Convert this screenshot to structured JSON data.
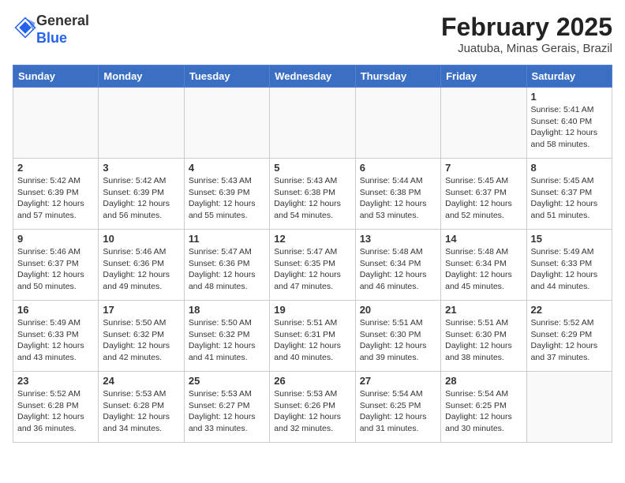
{
  "header": {
    "logo_general": "General",
    "logo_blue": "Blue",
    "month_title": "February 2025",
    "location": "Juatuba, Minas Gerais, Brazil"
  },
  "days_of_week": [
    "Sunday",
    "Monday",
    "Tuesday",
    "Wednesday",
    "Thursday",
    "Friday",
    "Saturday"
  ],
  "weeks": [
    [
      {
        "day": "",
        "info": ""
      },
      {
        "day": "",
        "info": ""
      },
      {
        "day": "",
        "info": ""
      },
      {
        "day": "",
        "info": ""
      },
      {
        "day": "",
        "info": ""
      },
      {
        "day": "",
        "info": ""
      },
      {
        "day": "1",
        "info": "Sunrise: 5:41 AM\nSunset: 6:40 PM\nDaylight: 12 hours\nand 58 minutes."
      }
    ],
    [
      {
        "day": "2",
        "info": "Sunrise: 5:42 AM\nSunset: 6:39 PM\nDaylight: 12 hours\nand 57 minutes."
      },
      {
        "day": "3",
        "info": "Sunrise: 5:42 AM\nSunset: 6:39 PM\nDaylight: 12 hours\nand 56 minutes."
      },
      {
        "day": "4",
        "info": "Sunrise: 5:43 AM\nSunset: 6:39 PM\nDaylight: 12 hours\nand 55 minutes."
      },
      {
        "day": "5",
        "info": "Sunrise: 5:43 AM\nSunset: 6:38 PM\nDaylight: 12 hours\nand 54 minutes."
      },
      {
        "day": "6",
        "info": "Sunrise: 5:44 AM\nSunset: 6:38 PM\nDaylight: 12 hours\nand 53 minutes."
      },
      {
        "day": "7",
        "info": "Sunrise: 5:45 AM\nSunset: 6:37 PM\nDaylight: 12 hours\nand 52 minutes."
      },
      {
        "day": "8",
        "info": "Sunrise: 5:45 AM\nSunset: 6:37 PM\nDaylight: 12 hours\nand 51 minutes."
      }
    ],
    [
      {
        "day": "9",
        "info": "Sunrise: 5:46 AM\nSunset: 6:37 PM\nDaylight: 12 hours\nand 50 minutes."
      },
      {
        "day": "10",
        "info": "Sunrise: 5:46 AM\nSunset: 6:36 PM\nDaylight: 12 hours\nand 49 minutes."
      },
      {
        "day": "11",
        "info": "Sunrise: 5:47 AM\nSunset: 6:36 PM\nDaylight: 12 hours\nand 48 minutes."
      },
      {
        "day": "12",
        "info": "Sunrise: 5:47 AM\nSunset: 6:35 PM\nDaylight: 12 hours\nand 47 minutes."
      },
      {
        "day": "13",
        "info": "Sunrise: 5:48 AM\nSunset: 6:34 PM\nDaylight: 12 hours\nand 46 minutes."
      },
      {
        "day": "14",
        "info": "Sunrise: 5:48 AM\nSunset: 6:34 PM\nDaylight: 12 hours\nand 45 minutes."
      },
      {
        "day": "15",
        "info": "Sunrise: 5:49 AM\nSunset: 6:33 PM\nDaylight: 12 hours\nand 44 minutes."
      }
    ],
    [
      {
        "day": "16",
        "info": "Sunrise: 5:49 AM\nSunset: 6:33 PM\nDaylight: 12 hours\nand 43 minutes."
      },
      {
        "day": "17",
        "info": "Sunrise: 5:50 AM\nSunset: 6:32 PM\nDaylight: 12 hours\nand 42 minutes."
      },
      {
        "day": "18",
        "info": "Sunrise: 5:50 AM\nSunset: 6:32 PM\nDaylight: 12 hours\nand 41 minutes."
      },
      {
        "day": "19",
        "info": "Sunrise: 5:51 AM\nSunset: 6:31 PM\nDaylight: 12 hours\nand 40 minutes."
      },
      {
        "day": "20",
        "info": "Sunrise: 5:51 AM\nSunset: 6:30 PM\nDaylight: 12 hours\nand 39 minutes."
      },
      {
        "day": "21",
        "info": "Sunrise: 5:51 AM\nSunset: 6:30 PM\nDaylight: 12 hours\nand 38 minutes."
      },
      {
        "day": "22",
        "info": "Sunrise: 5:52 AM\nSunset: 6:29 PM\nDaylight: 12 hours\nand 37 minutes."
      }
    ],
    [
      {
        "day": "23",
        "info": "Sunrise: 5:52 AM\nSunset: 6:28 PM\nDaylight: 12 hours\nand 36 minutes."
      },
      {
        "day": "24",
        "info": "Sunrise: 5:53 AM\nSunset: 6:28 PM\nDaylight: 12 hours\nand 34 minutes."
      },
      {
        "day": "25",
        "info": "Sunrise: 5:53 AM\nSunset: 6:27 PM\nDaylight: 12 hours\nand 33 minutes."
      },
      {
        "day": "26",
        "info": "Sunrise: 5:53 AM\nSunset: 6:26 PM\nDaylight: 12 hours\nand 32 minutes."
      },
      {
        "day": "27",
        "info": "Sunrise: 5:54 AM\nSunset: 6:25 PM\nDaylight: 12 hours\nand 31 minutes."
      },
      {
        "day": "28",
        "info": "Sunrise: 5:54 AM\nSunset: 6:25 PM\nDaylight: 12 hours\nand 30 minutes."
      },
      {
        "day": "",
        "info": ""
      }
    ]
  ]
}
